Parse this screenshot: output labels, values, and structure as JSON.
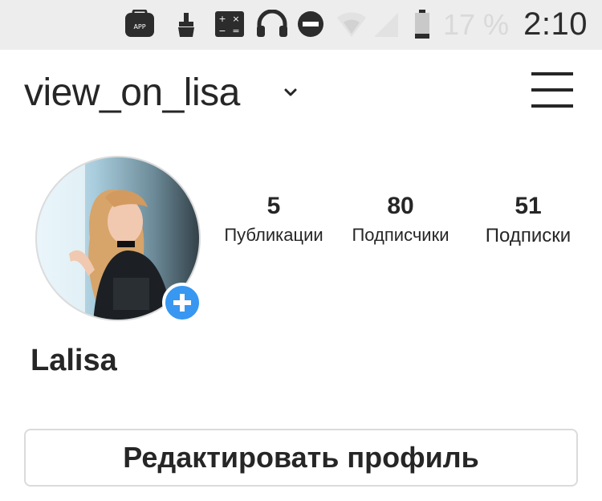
{
  "status_bar": {
    "icons": [
      "app-store-icon",
      "cleaner-brush-icon",
      "calculator-icon",
      "headphones-icon",
      "do-not-disturb-icon",
      "wifi-icon",
      "signal-icon",
      "battery-icon"
    ],
    "battery_percent": "17 %",
    "time": "2:10"
  },
  "header": {
    "username": "view_on_lisa",
    "icons": [
      "chevron-down-icon",
      "menu-icon"
    ]
  },
  "profile": {
    "avatar": "profile-photo",
    "stats": {
      "posts": {
        "value": "5",
        "label": "Публикации"
      },
      "followers": {
        "value": "80",
        "label": "Подписчики"
      },
      "following": {
        "value": "51",
        "label": "Подписки"
      }
    },
    "display_name": "Lalisa",
    "edit_button_label": "Редактировать профиль"
  },
  "colors": {
    "accent": "#3897f0",
    "status_bar_bg": "#ededed",
    "text": "#262626",
    "border": "#dbdbdb"
  }
}
